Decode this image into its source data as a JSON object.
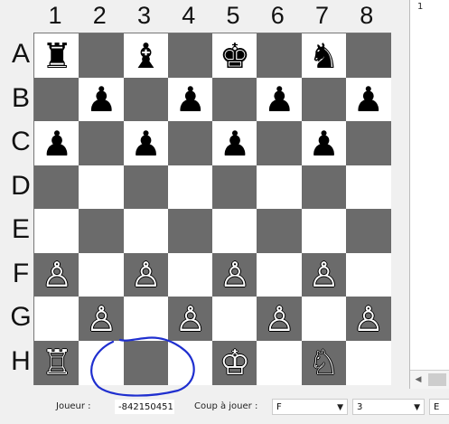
{
  "board": {
    "columns": [
      "1",
      "2",
      "3",
      "4",
      "5",
      "6",
      "7",
      "8"
    ],
    "rows": [
      "A",
      "B",
      "C",
      "D",
      "E",
      "F",
      "G",
      "H"
    ],
    "pieces": [
      {
        "row": "A",
        "col": 1,
        "glyph": "♜",
        "color": "black",
        "name": "rook"
      },
      {
        "row": "A",
        "col": 3,
        "glyph": "♝",
        "color": "black",
        "name": "bishop"
      },
      {
        "row": "A",
        "col": 5,
        "glyph": "♚",
        "color": "black",
        "name": "king"
      },
      {
        "row": "A",
        "col": 7,
        "glyph": "♞",
        "color": "black",
        "name": "knight"
      },
      {
        "row": "B",
        "col": 2,
        "glyph": "♟",
        "color": "black",
        "name": "pawn"
      },
      {
        "row": "B",
        "col": 4,
        "glyph": "♟",
        "color": "black",
        "name": "pawn"
      },
      {
        "row": "B",
        "col": 6,
        "glyph": "♟",
        "color": "black",
        "name": "pawn"
      },
      {
        "row": "B",
        "col": 8,
        "glyph": "♟",
        "color": "black",
        "name": "pawn"
      },
      {
        "row": "C",
        "col": 1,
        "glyph": "♟",
        "color": "black",
        "name": "pawn"
      },
      {
        "row": "C",
        "col": 3,
        "glyph": "♟",
        "color": "black",
        "name": "pawn"
      },
      {
        "row": "C",
        "col": 5,
        "glyph": "♟",
        "color": "black",
        "name": "pawn"
      },
      {
        "row": "C",
        "col": 7,
        "glyph": "♟",
        "color": "black",
        "name": "pawn"
      },
      {
        "row": "F",
        "col": 1,
        "glyph": "♙",
        "color": "white",
        "name": "pawn"
      },
      {
        "row": "F",
        "col": 3,
        "glyph": "♙",
        "color": "white",
        "name": "pawn"
      },
      {
        "row": "F",
        "col": 5,
        "glyph": "♙",
        "color": "white",
        "name": "pawn"
      },
      {
        "row": "F",
        "col": 7,
        "glyph": "♙",
        "color": "white",
        "name": "pawn"
      },
      {
        "row": "G",
        "col": 2,
        "glyph": "♙",
        "color": "white",
        "name": "pawn"
      },
      {
        "row": "G",
        "col": 4,
        "glyph": "♙",
        "color": "white",
        "name": "pawn"
      },
      {
        "row": "G",
        "col": 6,
        "glyph": "♙",
        "color": "white",
        "name": "pawn"
      },
      {
        "row": "G",
        "col": 8,
        "glyph": "♙",
        "color": "white",
        "name": "pawn"
      },
      {
        "row": "H",
        "col": 1,
        "glyph": "♖",
        "color": "white",
        "name": "rook"
      },
      {
        "row": "H",
        "col": 5,
        "glyph": "♔",
        "color": "white",
        "name": "king"
      },
      {
        "row": "H",
        "col": 7,
        "glyph": "♘",
        "color": "white",
        "name": "knight"
      }
    ],
    "colors": {
      "light": "#ffffff",
      "dark": "#6b6b6b",
      "annotation": "#1f2fcf"
    }
  },
  "side_panel": {
    "line_number": "1"
  },
  "status_bar": {
    "player_label": "Joueur :",
    "player_value": "-842150451",
    "move_label": "Coup à jouer :",
    "row_select": "F",
    "col_select": "3",
    "extra_select": "E"
  }
}
